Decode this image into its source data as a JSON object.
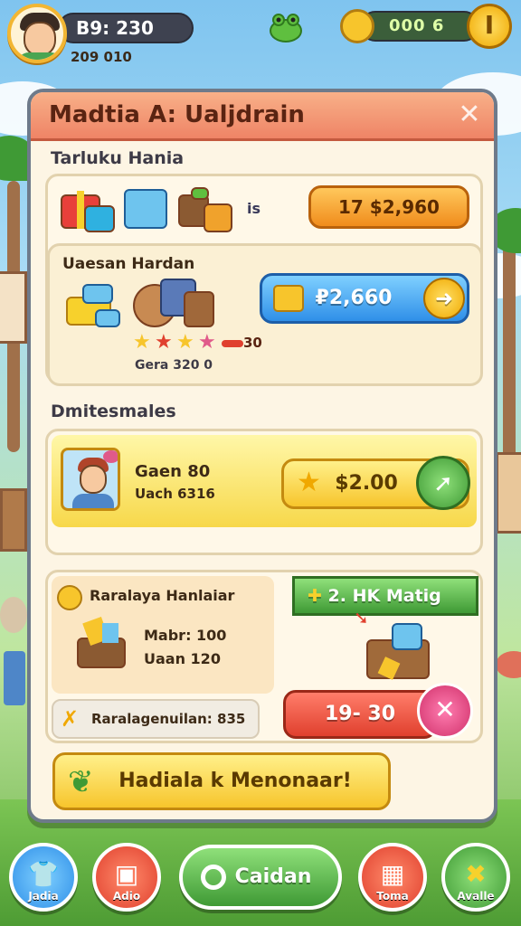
{
  "hud": {
    "player_name": "B9: 230",
    "player_sub": "209 010",
    "coin_value": "000 6",
    "coin_button_glyph": "I",
    "icons": [
      "avatar",
      "frog-icon",
      "coin-icon",
      "gold-coin-icon"
    ]
  },
  "panel": {
    "title": "Madtia A: Ualjdrain",
    "close_glyph": "✕",
    "section1_label": "Tarluku Hania",
    "row1": {
      "count_label": "is",
      "price_label": "17 $2,960"
    },
    "row2": {
      "title": "Uaesan Hardan",
      "price_label": "₽2,660",
      "stars_value_label": "30",
      "sub_label": "Gera 320 0",
      "stars_filled": 4
    },
    "section2_label": "Dmitesmales",
    "row3": {
      "line1": "Gaen 80",
      "line2": "Uach 6316",
      "price_label": "$2.00"
    },
    "row4": {
      "title": "Raralaya Hanlaiar",
      "line1": "Mabr: 100",
      "line2": "Uaan 120",
      "badge_label": "2. HK Matig",
      "timer_label": "19- 30",
      "footer_label": "Raralagenuilan: 835"
    },
    "cta_label": "Hadiala k Menonaar!"
  },
  "nav": {
    "items": [
      {
        "label": "Jadia",
        "icon": "shirt-icon",
        "color": "#2f8fe8"
      },
      {
        "label": "Adio",
        "icon": "shop-icon",
        "color": "#e0402e"
      },
      {
        "label": "Caidan",
        "icon": "search-icon",
        "color": "#4aa43a"
      },
      {
        "label": "Toma",
        "icon": "map-icon",
        "color": "#e0402e"
      },
      {
        "label": "Avalle",
        "icon": "tools-icon",
        "color": "#4aa43a"
      }
    ]
  },
  "colors": {
    "panel_header": "#ef8466",
    "accent_orange": "#f08c1c",
    "accent_blue": "#2f8fe8",
    "accent_yellow": "#f7c52c",
    "accent_green": "#4aa43a",
    "accent_red": "#e0402e"
  }
}
